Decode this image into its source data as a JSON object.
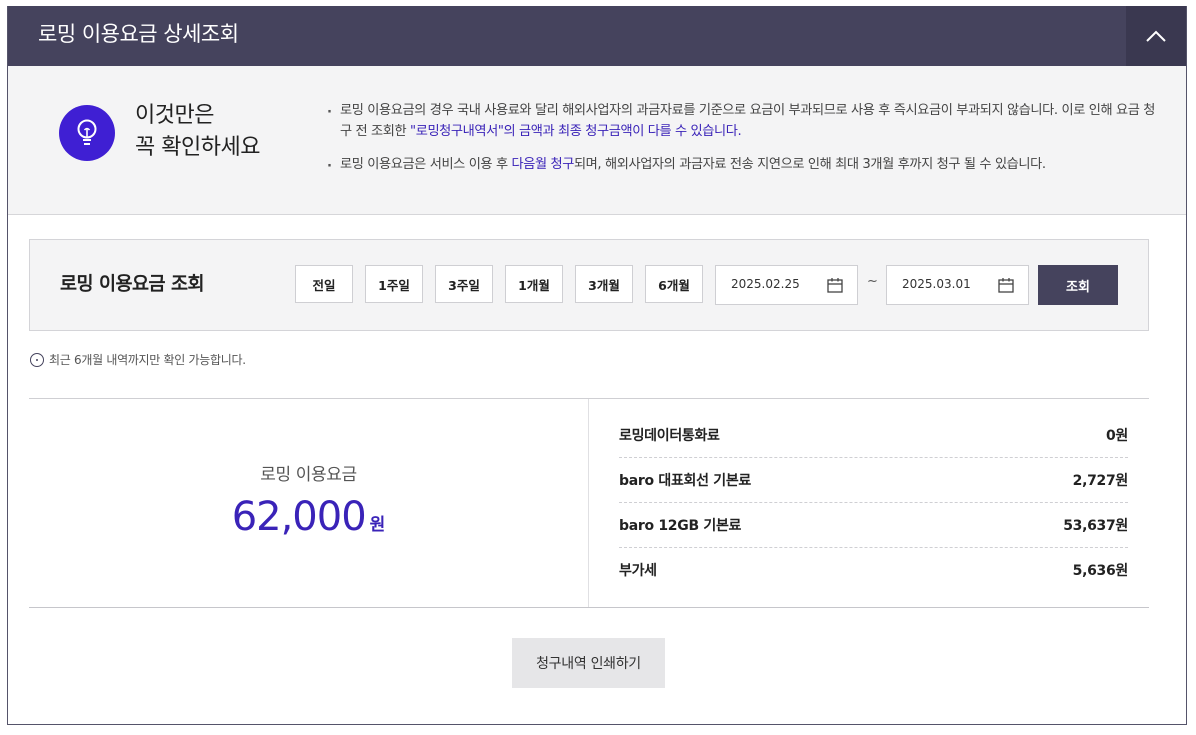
{
  "header": {
    "title": "로밍 이용요금 상세조회",
    "toggle_icon": "chevron-up-icon"
  },
  "notice": {
    "icon": "lightbulb-icon",
    "title_line1": "이것만은",
    "title_line2": "꼭 확인하세요",
    "item1": {
      "text_a": "로밍 이용요금의 경우 국내 사용료와 달리 해외사업자의 과금자료를 기준으로 요금이 부과되므로 사용 후 즉시요금이 부과되지 않습니다. 이로 인해 요금 청구 전 조회한 ",
      "highlight": "\"로밍청구내역서\"의 금액과 최종 청구금액이 다를 수 있습니다."
    },
    "item2": {
      "text_a": "로밍 이용요금은 서비스 이용 후 ",
      "highlight": "다음월 청구",
      "text_b": "되며, 해외사업자의 과금자료 전송 지연으로 인해 최대 3개월 후까지 청구 될 수 있습니다."
    }
  },
  "search": {
    "title": "로밍 이용요금 조회",
    "periods": [
      "전일",
      "1주일",
      "3주일",
      "1개월",
      "3개월",
      "6개월"
    ],
    "start_date": "2025.02.25",
    "end_date": "2025.03.01",
    "separator": "~",
    "submit_label": "조회",
    "calendar_icon": "calendar-icon"
  },
  "info_note": "최근 6개월 내역까지만 확인 가능합니다.",
  "summary": {
    "total_label": "로밍 이용요금",
    "total_amount": "62,000",
    "total_unit": "원",
    "items": [
      {
        "label": "로밍데이터통화료",
        "value": "0원"
      },
      {
        "label": "baro 대표회선 기본료",
        "value": "2,727원"
      },
      {
        "label": "baro 12GB 기본료",
        "value": "53,637원"
      },
      {
        "label": "부가세",
        "value": "5,636원"
      }
    ]
  },
  "print_button": "청구내역 인쇄하기",
  "colors": {
    "header_bg": "#45435d",
    "accent": "#3a23b8",
    "icon_bg": "#3f1fd3"
  }
}
